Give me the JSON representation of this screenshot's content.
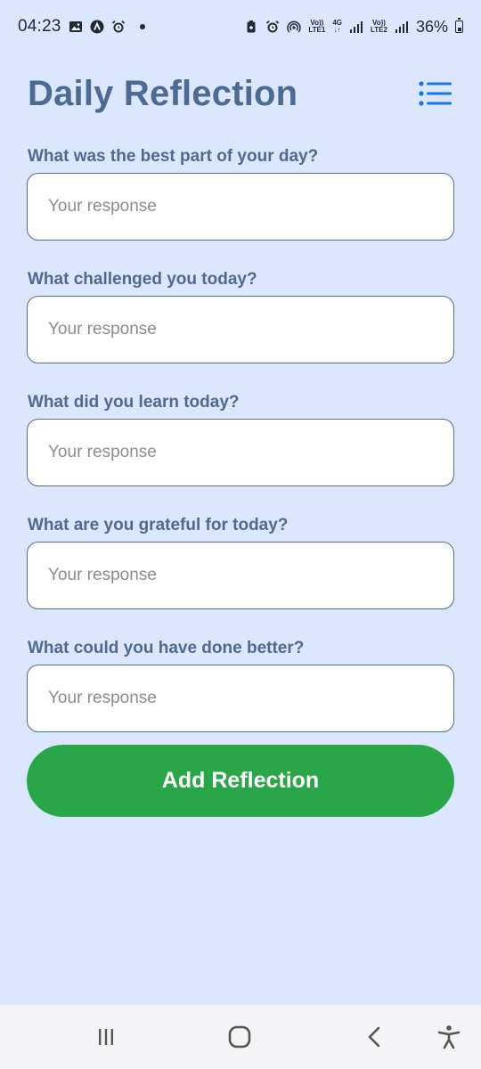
{
  "status_bar": {
    "time": "04:23",
    "net1_top": "Vo))",
    "net1_bottom": "LTE1",
    "net_type_top": "4G",
    "net_type_bottom": "↓↑",
    "net2_top": "Vo))",
    "net2_bottom": "LTE2",
    "battery_percent": "36%",
    "left_icons": [
      "gallery-icon",
      "app-a-icon",
      "alarm-icon",
      "dot-icon"
    ],
    "right_icons": [
      "battery-saver-icon",
      "alarm-icon",
      "hotspot-icon",
      "signal-icon",
      "signal-icon",
      "battery-icon"
    ]
  },
  "header": {
    "title": "Daily Reflection",
    "menu_icon": "list-icon"
  },
  "form": {
    "fields": [
      {
        "label": "What was the best part of your day?",
        "placeholder": "Your response",
        "value": ""
      },
      {
        "label": "What challenged you today?",
        "placeholder": "Your response",
        "value": ""
      },
      {
        "label": "What did you learn today?",
        "placeholder": "Your response",
        "value": ""
      },
      {
        "label": "What are you grateful for today?",
        "placeholder": "Your response",
        "value": ""
      },
      {
        "label": "What could you have done better?",
        "placeholder": "Your response",
        "value": ""
      }
    ],
    "submit_label": "Add Reflection"
  },
  "nav_bar": {
    "buttons": [
      "recents-icon",
      "home-icon",
      "back-icon",
      "accessibility-icon"
    ]
  },
  "colors": {
    "background": "#dae7fe",
    "title": "#4d6a92",
    "label": "#52698f",
    "accent": "#1a73e8",
    "button": "#29a748",
    "nav_background": "#f4f4f6"
  }
}
